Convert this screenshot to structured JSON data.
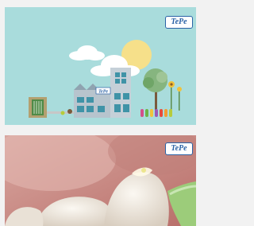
{
  "cards": [
    {
      "name": "factory-illustration-card",
      "logo_text": "TePe",
      "building_sign_text": "TePe",
      "colors": {
        "background": "#a9dcdc",
        "sun": "#f6e08a",
        "building": "#b7c4cd",
        "windows": "#3f93a7"
      }
    },
    {
      "name": "toothbrush-photo-card",
      "logo_text": "TePe",
      "colors": {
        "background": "#c98b86",
        "gums": "#d9a7a0",
        "teeth": "#f1ece4",
        "brush": "#9ccc7a"
      }
    }
  ],
  "brand": {
    "color": "#2a62a6"
  }
}
